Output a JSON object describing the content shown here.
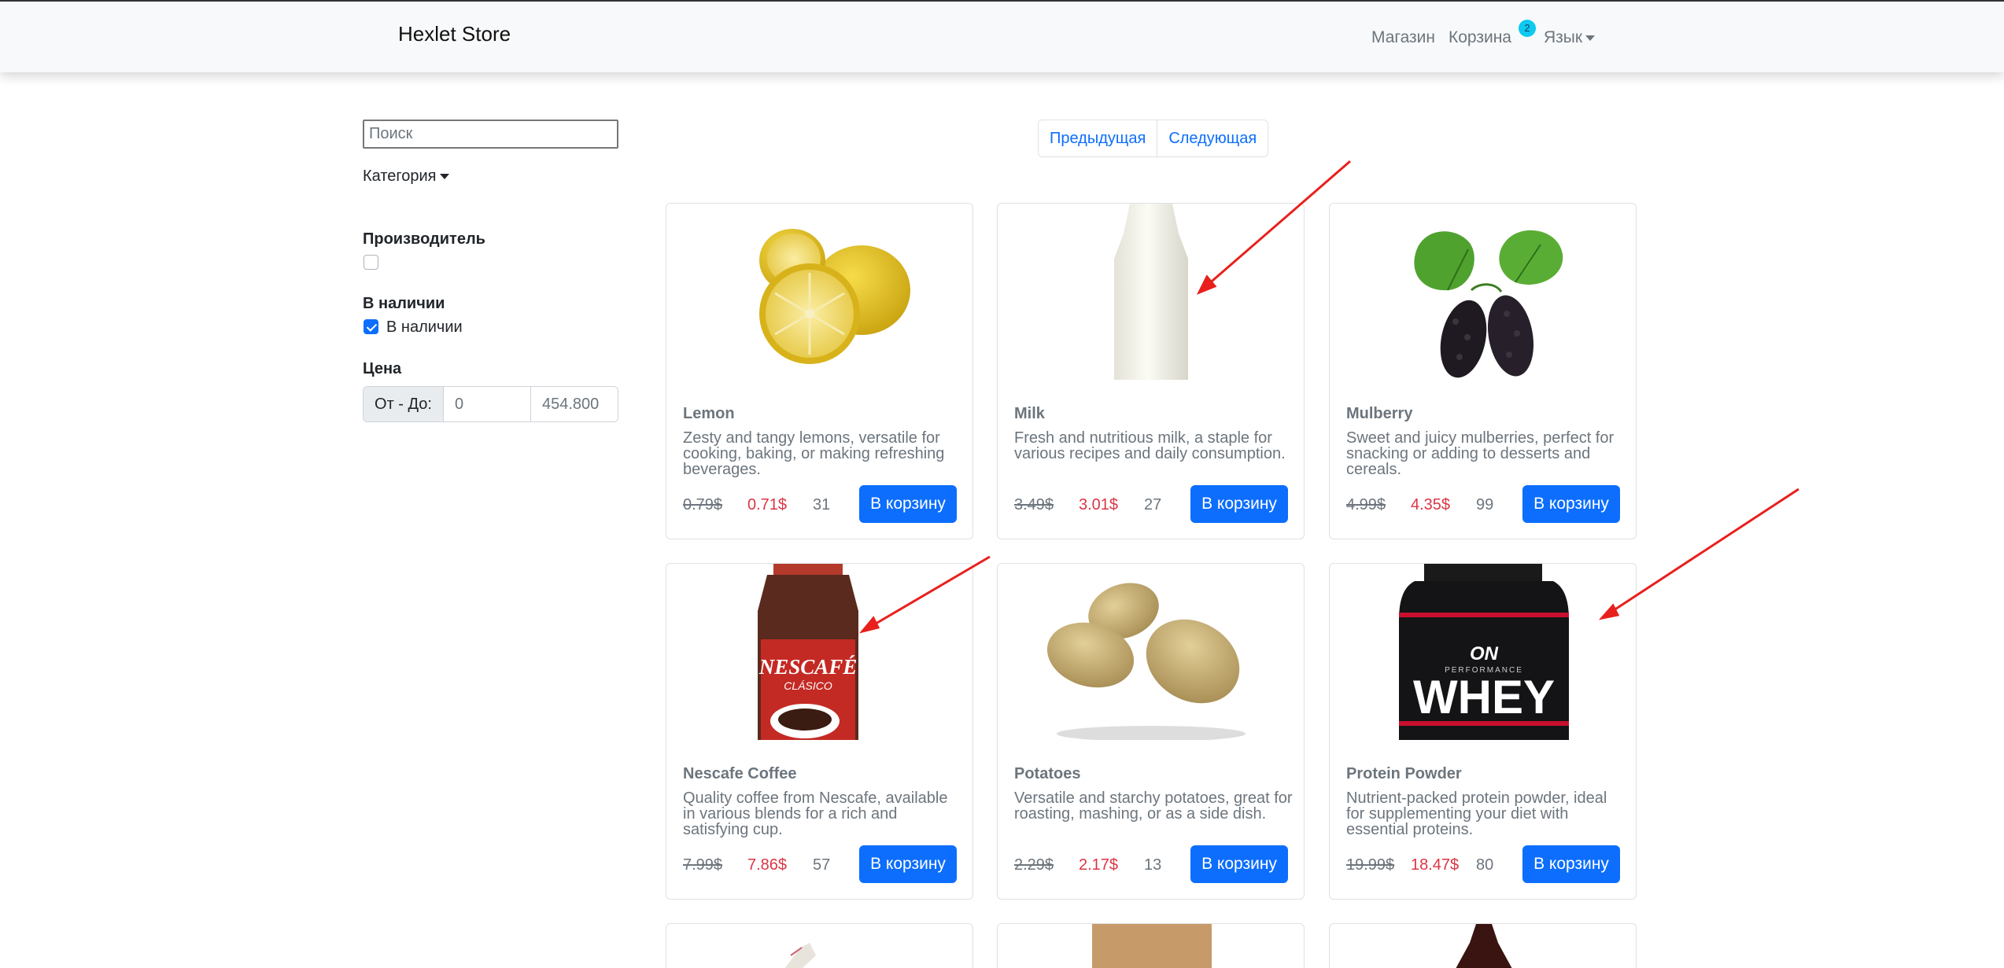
{
  "navbar": {
    "brand": "Hexlet Store",
    "links": {
      "shop": "Магазин",
      "cart": "Корзина",
      "cart_count": "2",
      "language": "Язык"
    }
  },
  "sidebar": {
    "search_placeholder": "Поиск",
    "category_label": "Категория",
    "manufacturer_title": "Производитель",
    "in_stock_title": "В наличии",
    "in_stock_label": "В наличии",
    "price_title": "Цена",
    "price_range_label": "От - До:",
    "price_from": "0",
    "price_to": "454.800"
  },
  "pagination": {
    "prev": "Предыдущая",
    "next": "Следующая"
  },
  "products": [
    {
      "name": "Lemon",
      "description": "Zesty and tangy lemons, versatile for cooking, baking, or making refreshing beverages.",
      "old_price": "0.79$",
      "price": "0.71$",
      "stock": "31",
      "button": "В корзину",
      "image": "lemon"
    },
    {
      "name": "Milk",
      "description": "Fresh and nutritious milk, a staple for various recipes and daily consumption.",
      "old_price": "3.49$",
      "price": "3.01$",
      "stock": "27",
      "button": "В корзину",
      "image": "milk"
    },
    {
      "name": "Mulberry",
      "description": "Sweet and juicy mulberries, perfect for snacking or adding to desserts and cereals.",
      "old_price": "4.99$",
      "price": "4.35$",
      "stock": "99",
      "button": "В корзину",
      "image": "mulberry"
    },
    {
      "name": "Nescafe Coffee",
      "description": "Quality coffee from Nescafe, available in various blends for a rich and satisfying cup.",
      "old_price": "7.99$",
      "price": "7.86$",
      "stock": "57",
      "button": "В корзину",
      "image": "coffee"
    },
    {
      "name": "Potatoes",
      "description": "Versatile and starchy potatoes, great for roasting, mashing, or as a side dish.",
      "old_price": "2.29$",
      "price": "2.17$",
      "stock": "13",
      "button": "В корзину",
      "image": "potatoes"
    },
    {
      "name": "Protein Powder",
      "description": "Nutrient-packed protein powder, ideal for supplementing your diet with essential proteins.",
      "old_price": "19.99$",
      "price": "18.47$",
      "stock": "80",
      "button": "В корзину",
      "image": "protein"
    }
  ],
  "coffee_label": {
    "brand": "NESCAFÉ",
    "variant": "CLÁSICO"
  },
  "protein_label": {
    "logo": "ON",
    "line": "PERFORMANCE",
    "product": "WHEY"
  },
  "colors": {
    "primary": "#0d6efd",
    "sale": "#dc3545",
    "muted": "#6c757d",
    "annotation": "#e8201c"
  }
}
